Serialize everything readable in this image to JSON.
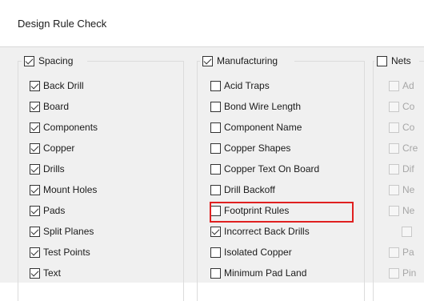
{
  "window": {
    "title": "Design Rule Check"
  },
  "spacing": {
    "label": "Spacing",
    "checked": true,
    "items": [
      {
        "label": "Back Drill",
        "checked": true
      },
      {
        "label": "Board",
        "checked": true
      },
      {
        "label": "Components",
        "checked": true
      },
      {
        "label": "Copper",
        "checked": true
      },
      {
        "label": "Drills",
        "checked": true
      },
      {
        "label": "Mount Holes",
        "checked": true
      },
      {
        "label": "Pads",
        "checked": true
      },
      {
        "label": "Split Planes",
        "checked": true
      },
      {
        "label": "Test Points",
        "checked": true
      },
      {
        "label": "Text",
        "checked": true
      }
    ]
  },
  "manufacturing": {
    "label": "Manufacturing",
    "checked": true,
    "items": [
      {
        "label": "Acid Traps",
        "checked": false
      },
      {
        "label": "Bond Wire Length",
        "checked": false
      },
      {
        "label": "Component Name",
        "checked": false
      },
      {
        "label": "Copper Shapes",
        "checked": false
      },
      {
        "label": "Copper Text On Board",
        "checked": false
      },
      {
        "label": "Drill Backoff",
        "checked": false
      },
      {
        "label": "Footprint Rules",
        "checked": false
      },
      {
        "label": "Incorrect Back Drills",
        "checked": true
      },
      {
        "label": "Isolated Copper",
        "checked": false
      },
      {
        "label": "Minimum Pad Land",
        "checked": false
      }
    ]
  },
  "nets": {
    "label": "Nets",
    "checked": false,
    "items": [
      {
        "label": "Ad",
        "checked": false
      },
      {
        "label": "Co",
        "checked": false
      },
      {
        "label": "Co",
        "checked": false
      },
      {
        "label": "Cre",
        "checked": false
      },
      {
        "label": "Dif",
        "checked": false
      },
      {
        "label": "Ne",
        "checked": false
      },
      {
        "label": "Ne",
        "checked": false
      },
      {
        "label": "",
        "checked": false
      },
      {
        "label": "Pa",
        "checked": false
      },
      {
        "label": "Pin",
        "checked": false
      }
    ]
  },
  "highlight_color": "#e02020"
}
